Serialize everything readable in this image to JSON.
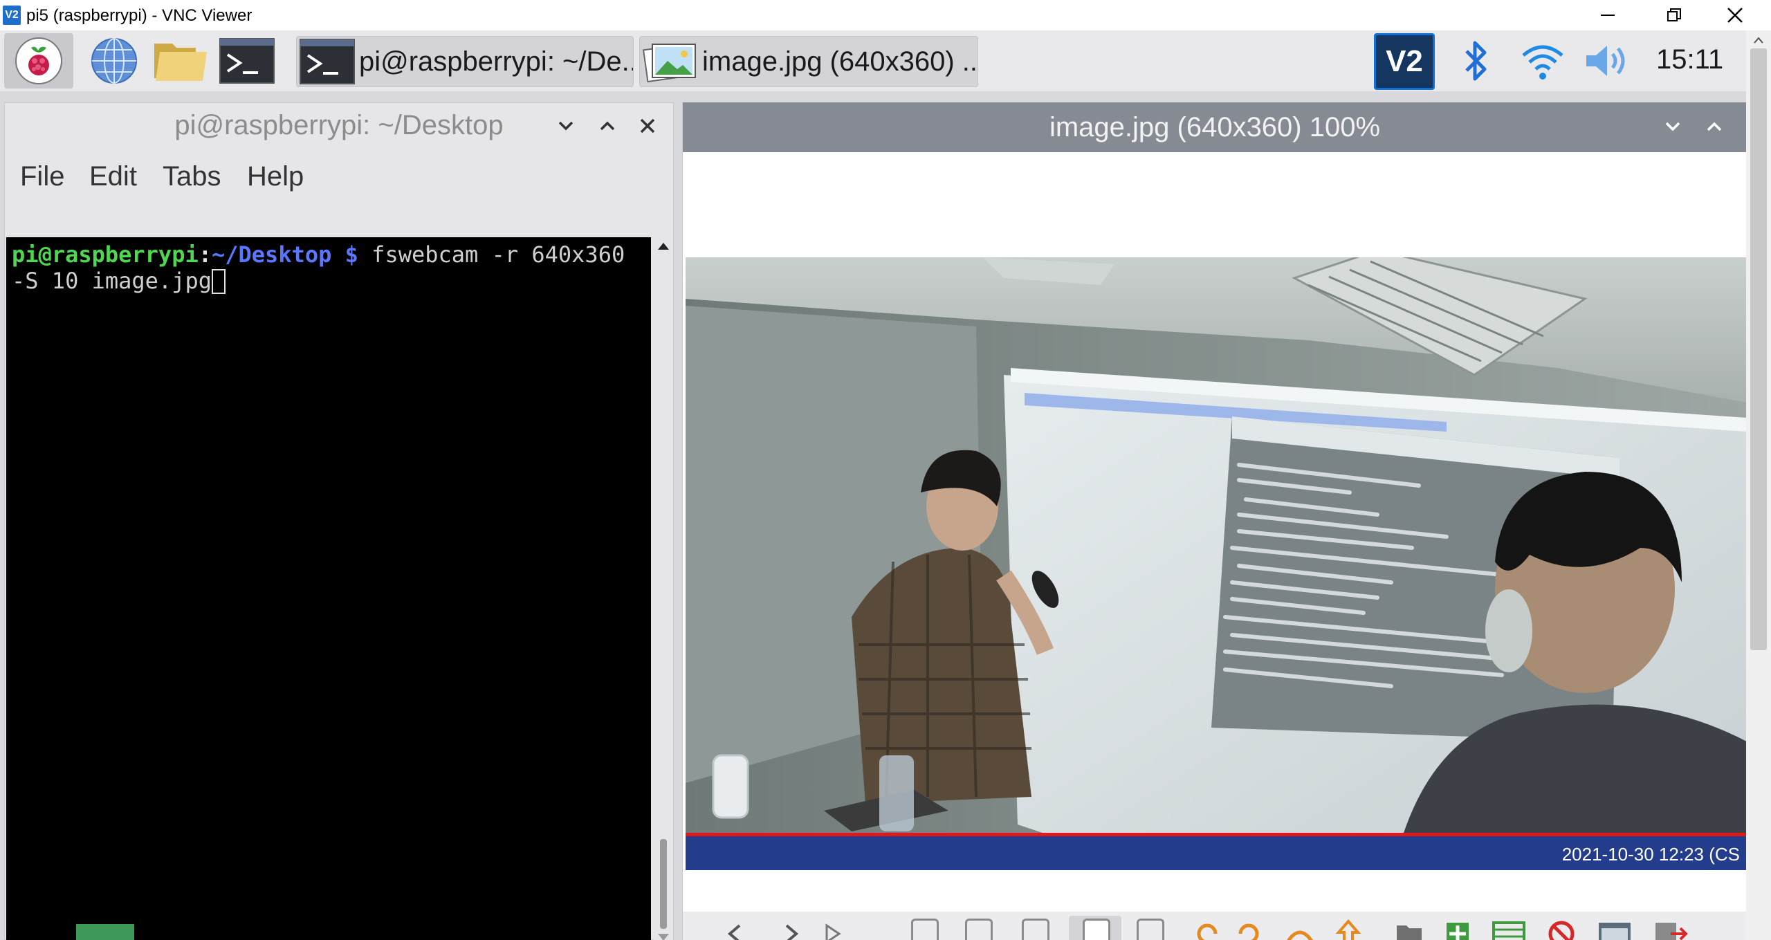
{
  "vnc_window": {
    "logo_text": "V2",
    "title": "pi5 (raspberrypi) - VNC Viewer",
    "controls": {
      "minimize": "—",
      "maximize": "❐",
      "close": "✕"
    }
  },
  "taskbar": {
    "launchers": [
      "raspberry-menu",
      "web-browser",
      "file-manager",
      "terminal"
    ],
    "tasks": [
      {
        "label": "pi@raspberrypi: ~/De...",
        "icon": "terminal-icon"
      },
      {
        "label": "image.jpg (640x360) ...",
        "icon": "image-viewer-icon"
      }
    ],
    "tray": {
      "vnc_logo": "V2",
      "clock": "15:11"
    }
  },
  "terminal": {
    "title": "pi@raspberrypi: ~/Desktop",
    "menu": [
      "File",
      "Edit",
      "Tabs",
      "Help"
    ],
    "prompt_user": "pi@raspberrypi",
    "prompt_sep": ":",
    "prompt_path": "~/Desktop $",
    "command": " fswebcam -r 640x360",
    "command_cont": "-S 10 image.jpg"
  },
  "image_viewer": {
    "title": "image.jpg (640x360) 100%",
    "timestamp": "2021-10-30 12:23 (CS"
  },
  "colors": {
    "prompt_user": "#4fd84f",
    "prompt_path": "#5a78ff",
    "terminal_bg": "#000000",
    "viewer_titlebar": "#858a93",
    "webcam_banner": "#233c8c",
    "banner_line": "#e01818"
  }
}
